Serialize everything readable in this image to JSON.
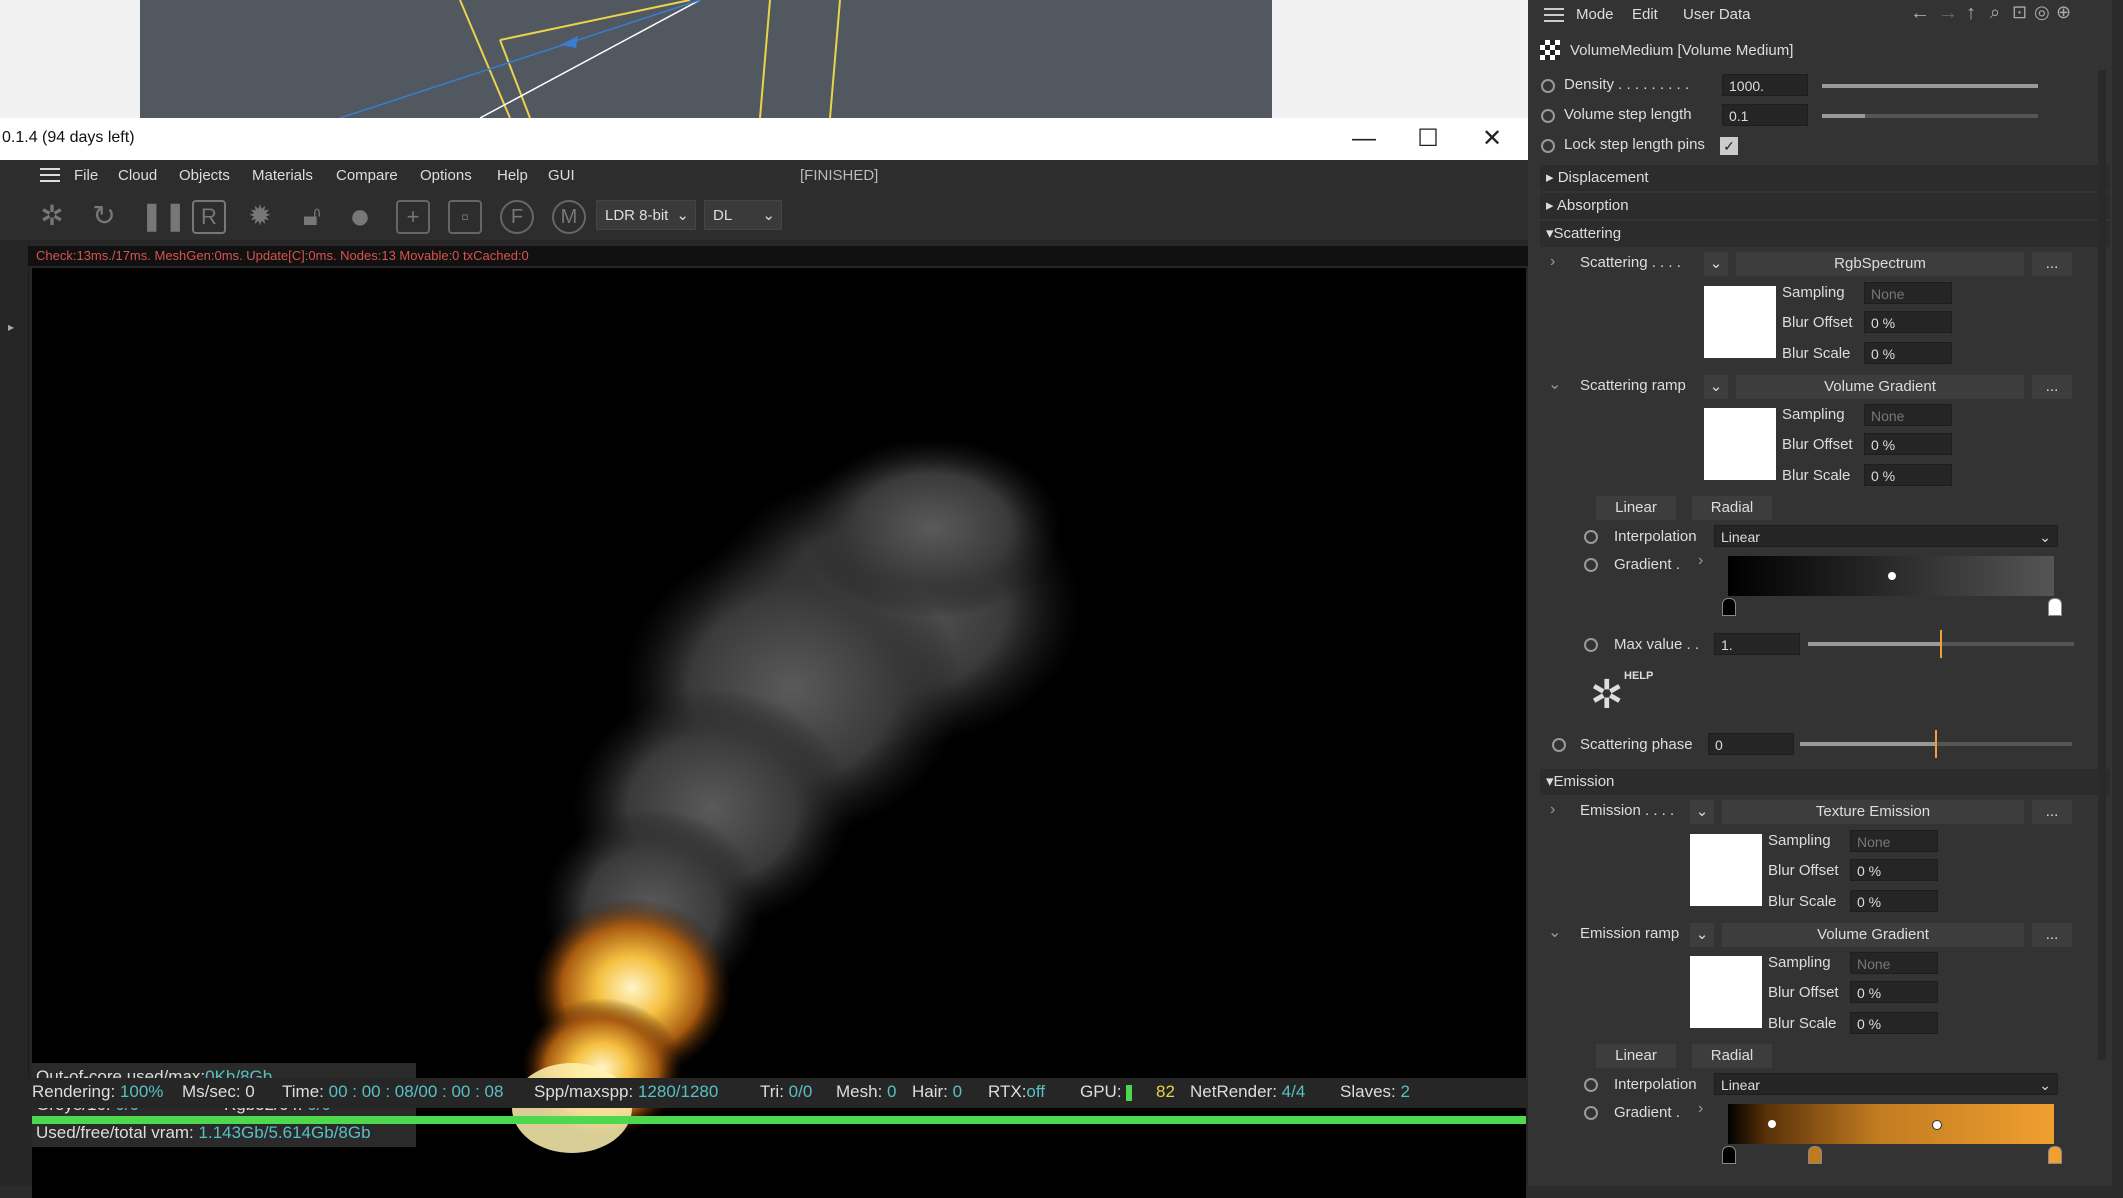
{
  "window": {
    "title": "0.1.4 (94 days left)",
    "minimize": "—",
    "maximize": "☐",
    "close": "✕"
  },
  "menu": [
    "File",
    "Cloud",
    "Objects",
    "Materials",
    "Compare",
    "Options",
    "Help",
    "GUI"
  ],
  "status_finished": "[FINISHED]",
  "toolbar": {
    "ldr_select": "LDR 8-bit",
    "dl_select": "DL"
  },
  "infoline": "Check:13ms./17ms. MeshGen:0ms. Update[C]:0ms. Nodes:13 Movable:0 txCached:0",
  "stats": {
    "outofcore_label": "Out-of-core used/max:",
    "outofcore_value": "0Kb/8Gb",
    "grey_label": "Grey8/16:",
    "grey_value": "0/0",
    "rgb_label": "Rgb32/64:",
    "rgb_value": "0/0",
    "vram_label": "Used/free/total vram:",
    "vram_value": "1.143Gb/5.614Gb/8Gb"
  },
  "statusbar": {
    "rendering_label": "Rendering:",
    "rendering_value": "100%",
    "mssec_label": "Ms/sec:",
    "mssec_value": "0",
    "time_label": "Time:",
    "time_value": "00 : 00 : 08/00 : 00 : 08",
    "spp_label": "Spp/maxspp:",
    "spp_value": "1280/1280",
    "tri_label": "Tri:",
    "tri_value": "0/0",
    "mesh_label": "Mesh:",
    "mesh_value": "0",
    "hair_label": "Hair:",
    "hair_value": "0",
    "rtx_label": "RTX:",
    "rtx_value": "off",
    "gpu_label": "GPU:",
    "gpu_value": "82",
    "netrender_label": "NetRender:",
    "netrender_value": "4/4",
    "slaves_label": "Slaves:",
    "slaves_value": "2"
  },
  "progress_fraction": 1.0,
  "panel": {
    "menu": [
      "Mode",
      "Edit",
      "User Data"
    ],
    "object_title": "VolumeMedium [Volume Medium]",
    "density_label": "Density . . . . . . . . .",
    "density_value": "1000.",
    "density_fraction": 1.0,
    "step_label": "Volume step length",
    "step_value": "0.1",
    "step_fraction": 0.2,
    "lock_label": "Lock step length pins",
    "sections": {
      "displacement": "Displacement",
      "absorption": "Absorption",
      "scattering": "Scattering",
      "emission": "Emission"
    },
    "scattering": {
      "label": "Scattering . . . .",
      "shader": "RgbSpectrum",
      "more": "...",
      "sampling_label": "Sampling",
      "sampling_value": "None",
      "bluroffset_label": "Blur Offset",
      "bluroffset_value": "0 %",
      "blurscale_label": "Blur Scale",
      "blurscale_value": "0 %"
    },
    "scattering_ramp": {
      "label": "Scattering ramp",
      "shader": "Volume Gradient",
      "more": "...",
      "sampling_label": "Sampling",
      "sampling_value": "None",
      "bluroffset_label": "Blur Offset",
      "bluroffset_value": "0 %",
      "blurscale_label": "Blur Scale",
      "blurscale_value": "0 %",
      "linear_btn": "Linear",
      "radial_btn": "Radial",
      "interp_label": "Interpolation",
      "interp_value": "Linear",
      "gradient_label": "Gradient .",
      "maxvalue_label": "Max value . .",
      "maxvalue_value": "1.",
      "maxvalue_fraction": 0.5,
      "help_label": "HELP",
      "phase_label": "Scattering phase",
      "phase_value": "0",
      "phase_fraction": 0.5
    },
    "emission": {
      "label": "Emission . . . .",
      "shader": "Texture Emission",
      "more": "...",
      "sampling_label": "Sampling",
      "sampling_value": "None",
      "bluroffset_label": "Blur Offset",
      "bluroffset_value": "0 %",
      "blurscale_label": "Blur Scale",
      "blurscale_value": "0 %"
    },
    "emission_ramp": {
      "label": "Emission ramp",
      "shader": "Volume Gradient",
      "more": "...",
      "sampling_label": "Sampling",
      "sampling_value": "None",
      "bluroffset_label": "Blur Offset",
      "bluroffset_value": "0 %",
      "blurscale_label": "Blur Scale",
      "blurscale_value": "0 %",
      "linear_btn": "Linear",
      "radial_btn": "Radial",
      "interp_label": "Interpolation",
      "interp_value": "Linear",
      "gradient_label": "Gradient ."
    }
  },
  "colors": {
    "accent_orange": "#f0a030",
    "status_cyan": "#58c0c4",
    "info_red": "#d9534f",
    "progress_green": "#4ed84e"
  }
}
